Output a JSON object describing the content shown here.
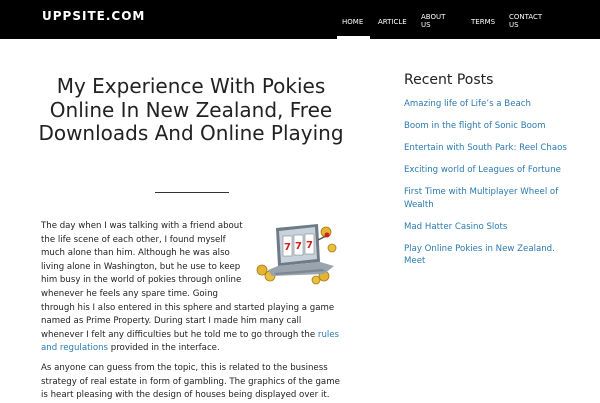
{
  "header": {
    "logo": "UPPSITE.COM",
    "nav": {
      "home": "HOME",
      "article": "ARTICLE",
      "about": "ABOUT US",
      "terms": "TERMS",
      "contact": "CONTACT US"
    }
  },
  "post": {
    "title": "My Experience With Pokies Online In New Zealand, Free Downloads And Online Playing",
    "p1_lines": [
      "The day when I was talking with a friend about",
      "the life scene of each other, I found myself",
      "much alone than him. Although he was also",
      "living alone in Washington, but he use to keep",
      "him busy in the world of pokies through online",
      "whenever he feels any spare time. Going",
      "through his I also entered in this sphere and started playing a game",
      "named as Prime Property. During start I made him many call",
      "whenever I felt any difficulties but he told me to go through the"
    ],
    "p1_link": "rules",
    "p1_link2": "and regulations",
    "p1_tail": " provided in the interface.",
    "p2_lines": [
      "As anyone can guess from the topic, this is related to the business",
      "strategy of real estate in form of gambling. The graphics of the game",
      "is heart pleasing with the design of houses being displayed over it."
    ]
  },
  "sidebar": {
    "title": "Recent Posts",
    "items": [
      "Amazing life of Life’s a Beach",
      "Boom in the flight of Sonic Boom",
      "Entertain with South Park: Reel Chaos",
      "Exciting world of Leagues of Fortune",
      "First Time with Multiplayer Wheel of Wealth",
      "Mad Hatter Casino Slots",
      "Play Online Pokies in New Zealand. Meet"
    ]
  },
  "colors": {
    "link": "#2a7ab0",
    "topbar": "#000000"
  }
}
